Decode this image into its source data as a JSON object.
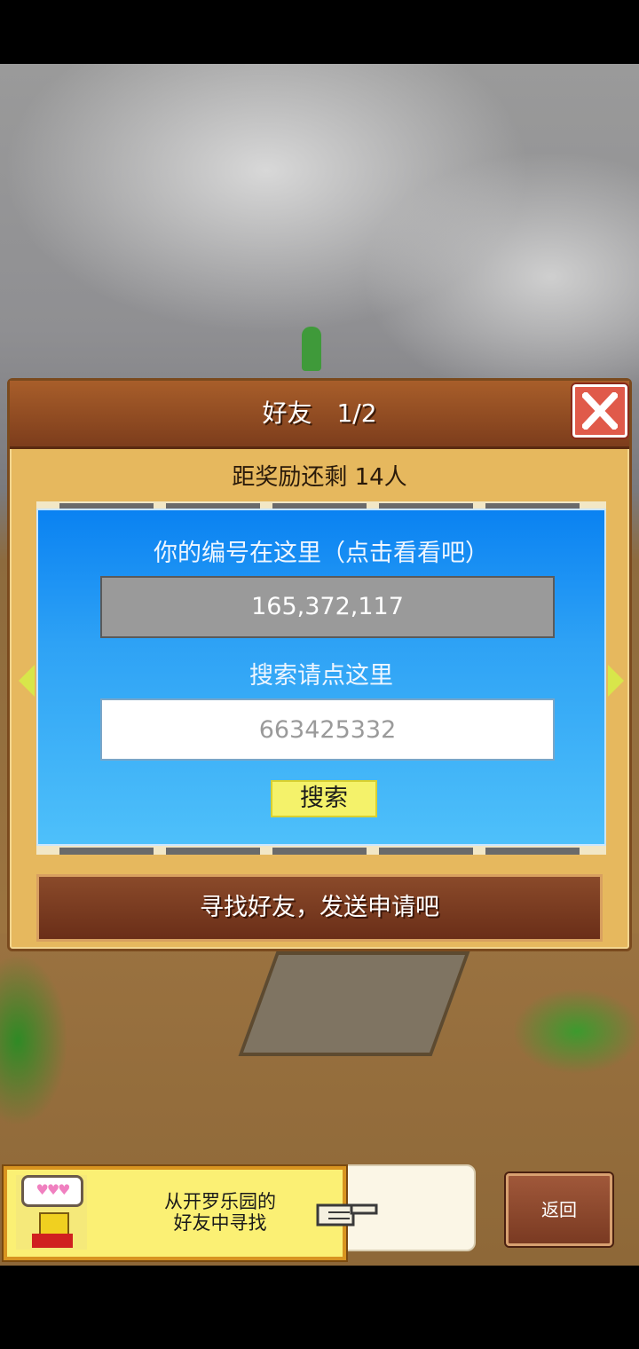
{
  "dialog": {
    "title": "好友　1/2",
    "reward_text": "距奖励还剩 14人",
    "close_icon": "close-x-icon",
    "id_label": "你的编号在这里（点击看看吧）",
    "player_id": "165,372,117",
    "search_label": "搜索请点这里",
    "search_placeholder": "663425332",
    "search_button": "搜索",
    "find_button": "寻找好友，发送申请吧"
  },
  "hint": {
    "speech": "♥♥♥",
    "line1": "从开罗乐园的",
    "line2": "好友中寻找"
  },
  "back_button": "返回",
  "colors": {
    "panel_blue": "#2ea2f5",
    "header_brown": "#7d3d1c",
    "close_red": "#e05a4a",
    "hint_yellow": "#fbf074"
  }
}
